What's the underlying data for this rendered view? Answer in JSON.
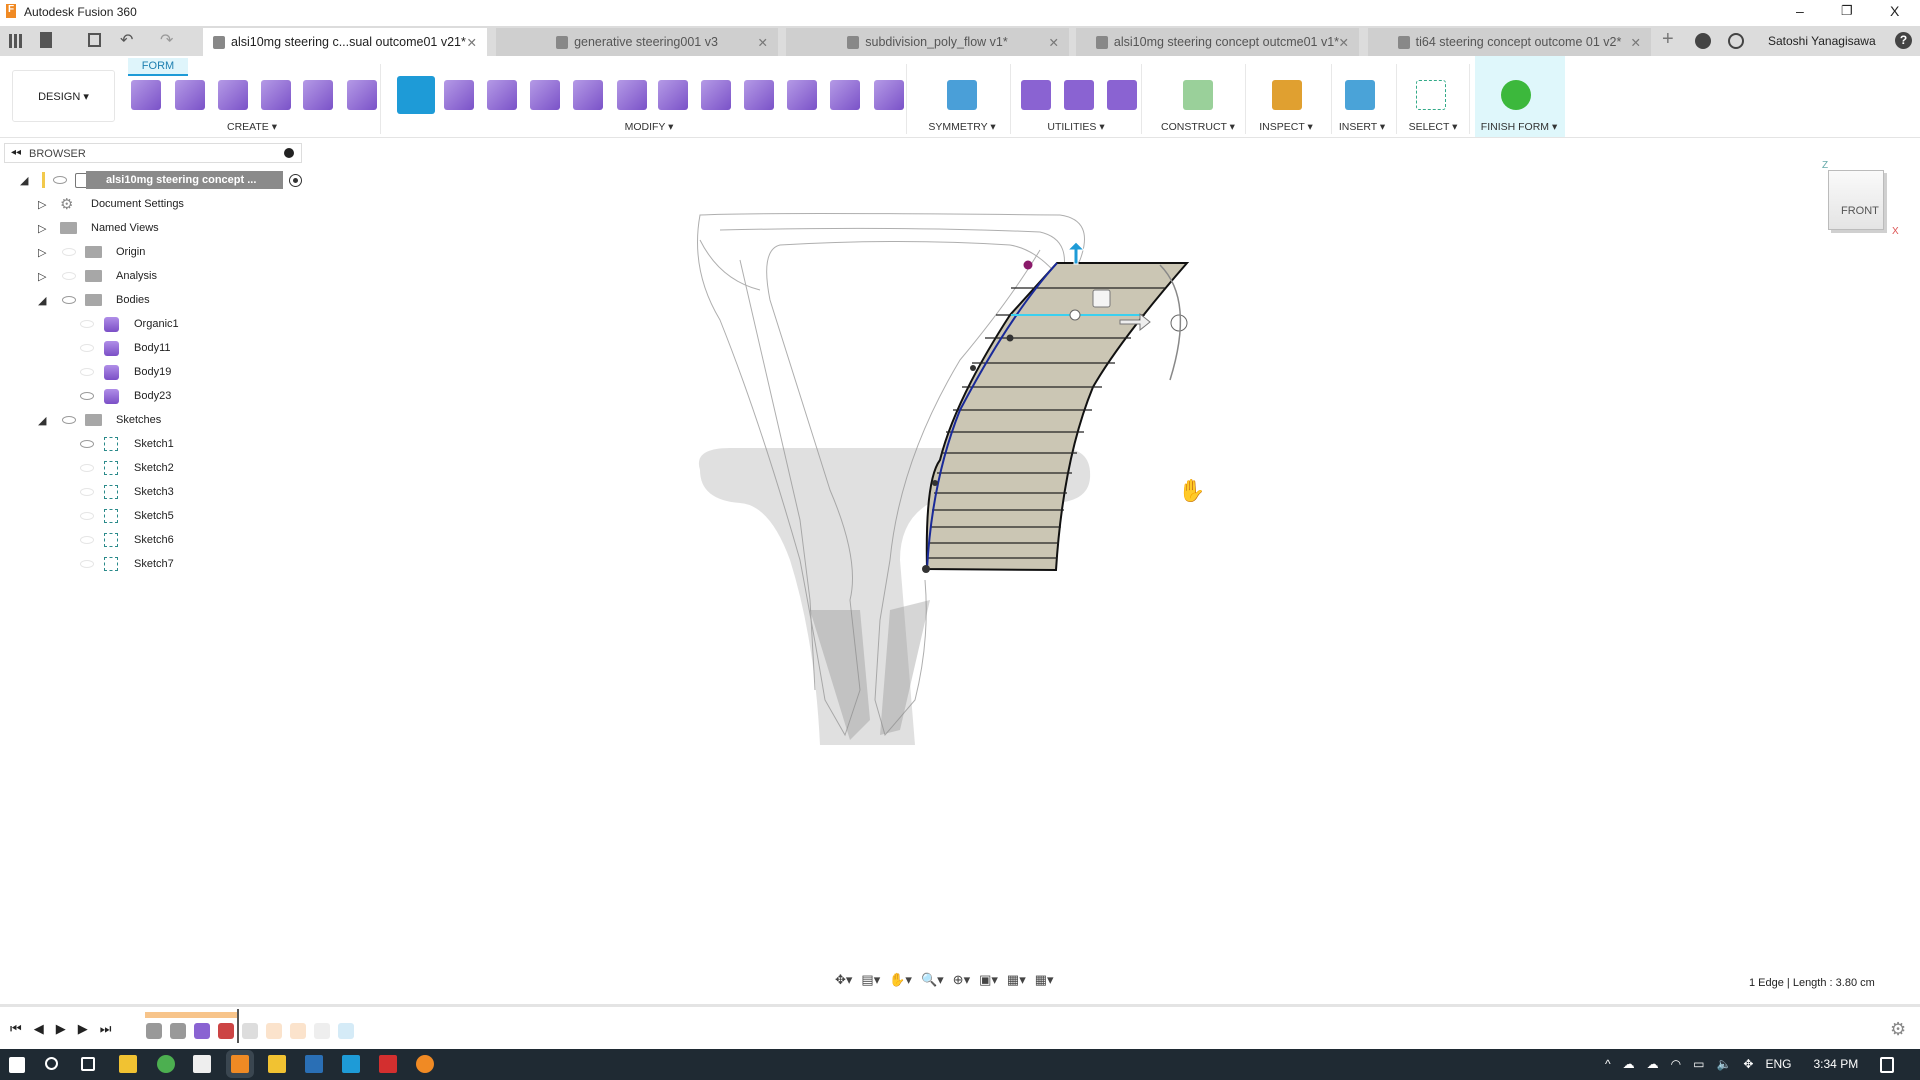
{
  "app": {
    "title": "Autodesk Fusion 360",
    "minimize": "–",
    "restore": "❐",
    "close": "X"
  },
  "tabs": [
    {
      "label": "alsi10mg steering c...sual outcome01 v21*",
      "active": true
    },
    {
      "label": "generative steering001 v3",
      "active": false
    },
    {
      "label": "subdivision_poly_flow v1*",
      "active": false
    },
    {
      "label": "alsi10mg steering concept outcme01 v1*",
      "active": false
    },
    {
      "label": "ti64 steering concept outcome 01 v2*",
      "active": false
    }
  ],
  "user": {
    "name": "Satoshi Yanagisawa",
    "help": "?"
  },
  "toolbar": {
    "workspace": "DESIGN ▾",
    "form_tab": "FORM",
    "groups": [
      "CREATE ▾",
      "MODIFY ▾",
      "SYMMETRY ▾",
      "UTILITIES ▾",
      "CONSTRUCT ▾",
      "INSPECT ▾",
      "INSERT ▾",
      "SELECT ▾",
      "FINISH FORM ▾"
    ],
    "tools": [
      "create-form-sketch",
      "box",
      "plane",
      "cylinder",
      "sphere",
      "face",
      "edit-form",
      "insert-edge",
      "subdivide",
      "insert-point",
      "merge-edge",
      "bridge",
      "fill-hole",
      "erase-and-fill",
      "weld-vertices",
      "unweld-edges",
      "crease",
      "uncrease"
    ]
  },
  "browser": {
    "title": "BROWSER",
    "root": "alsi10mg steering concept ...",
    "items": [
      {
        "label": "Document Settings",
        "level": 1,
        "type": "settings",
        "expander": "closed",
        "eye": "none"
      },
      {
        "label": "Named Views",
        "level": 1,
        "type": "folder",
        "expander": "closed",
        "eye": "none"
      },
      {
        "label": "Origin",
        "level": 1,
        "type": "folder",
        "expander": "closed",
        "eye": "off"
      },
      {
        "label": "Analysis",
        "level": 1,
        "type": "folder",
        "expander": "closed",
        "eye": "off"
      },
      {
        "label": "Bodies",
        "level": 1,
        "type": "folder",
        "expander": "open",
        "eye": "on"
      },
      {
        "label": "Organic1",
        "level": 2,
        "type": "body",
        "eye": "off"
      },
      {
        "label": "Body11",
        "level": 2,
        "type": "body",
        "eye": "off"
      },
      {
        "label": "Body19",
        "level": 2,
        "type": "body",
        "eye": "off"
      },
      {
        "label": "Body23",
        "level": 2,
        "type": "body",
        "eye": "on"
      },
      {
        "label": "Sketches",
        "level": 1,
        "type": "folder",
        "expander": "open",
        "eye": "on"
      },
      {
        "label": "Sketch1",
        "level": 2,
        "type": "sketch",
        "eye": "on"
      },
      {
        "label": "Sketch2",
        "level": 2,
        "type": "sketch",
        "eye": "off"
      },
      {
        "label": "Sketch3",
        "level": 2,
        "type": "sketch",
        "eye": "off"
      },
      {
        "label": "Sketch5",
        "level": 2,
        "type": "sketch",
        "eye": "off"
      },
      {
        "label": "Sketch6",
        "level": 2,
        "type": "sketch",
        "eye": "off"
      },
      {
        "label": "Sketch7",
        "level": 2,
        "type": "sketch",
        "eye": "off"
      }
    ]
  },
  "viewcube": {
    "face": "FRONT",
    "z": "Z",
    "x": "X"
  },
  "status": {
    "selection": "1 Edge | Length : 3.80 cm"
  },
  "navbar": [
    "orbit",
    "look-at",
    "pan",
    "zoom",
    "fit",
    "display-settings",
    "grid",
    "viewports"
  ],
  "taskbar": {
    "lang": "ENG",
    "time": "3:34 PM"
  },
  "colors": {
    "accent": "#1e9bd7",
    "form_purple": "#8a63d2",
    "finish_green": "#3cb83c",
    "surface": "#c9c4b2"
  }
}
